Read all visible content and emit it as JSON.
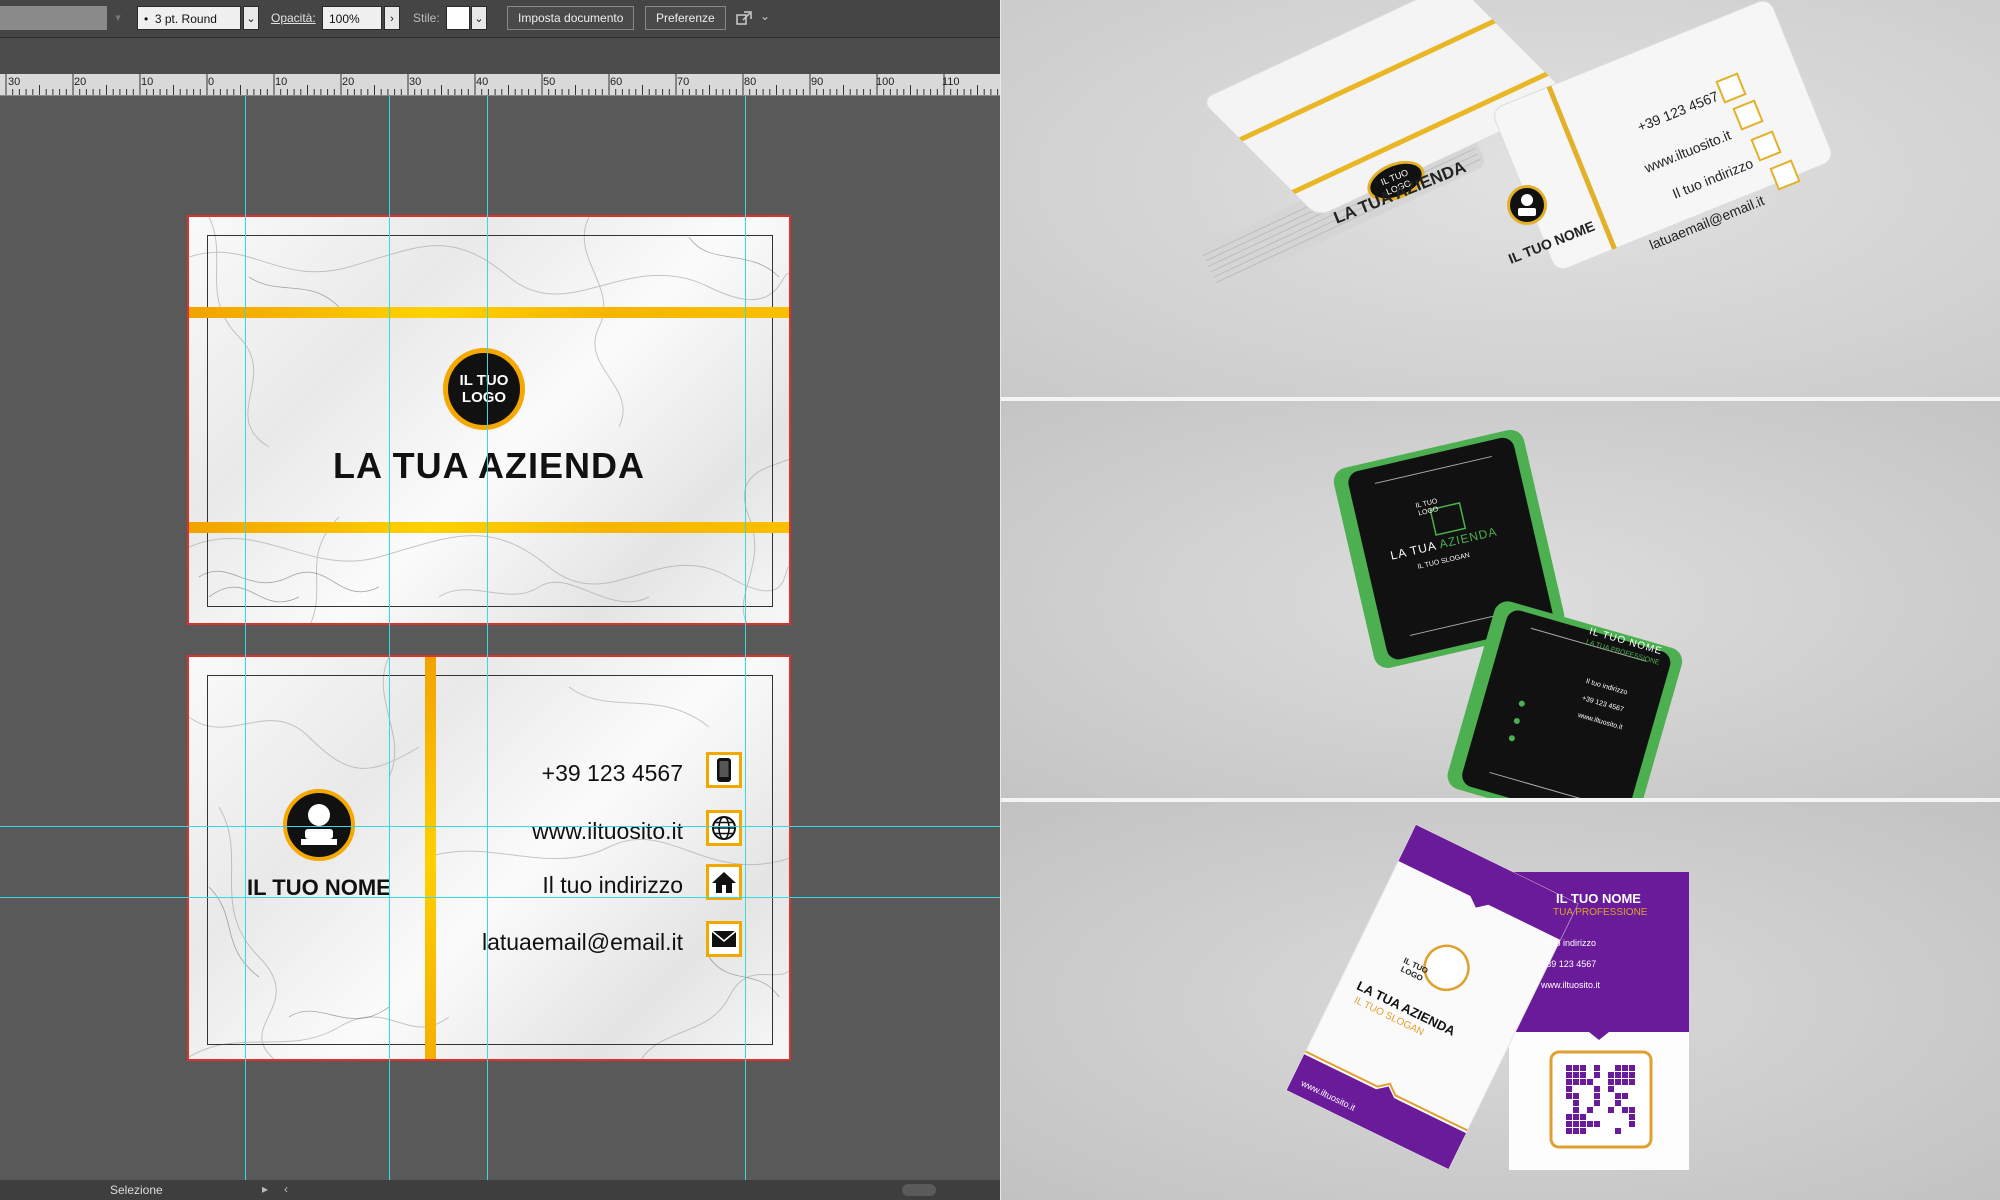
{
  "toolbar": {
    "stroke_profile": "3 pt. Round",
    "opacity_label": "Opacità:",
    "opacity_value": "100%",
    "style_label": "Stile:",
    "document_setup_button": "Imposta documento",
    "preferences_button": "Preferenze"
  },
  "ruler": {
    "ticks": [
      "30",
      "20",
      "10",
      "0",
      "10",
      "20",
      "30",
      "40",
      "50",
      "60",
      "70",
      "80",
      "90",
      "100",
      "110"
    ]
  },
  "front_card": {
    "logo_line1": "IL TUO",
    "logo_line2": "LOGO",
    "company": "LA TUA AZIENDA"
  },
  "back_card": {
    "name": "IL TUO NOME",
    "phone": "+39 123 4567",
    "website": "www.iltuosito.it",
    "address": "Il tuo indirizzo",
    "email": "latuaemail@email.it"
  },
  "status_bar": {
    "tool": "Selezione"
  },
  "mockup_marble": {
    "logo_line1": "IL TUO",
    "logo_line2": "LOGO",
    "company": "LA TUA AZIENDA",
    "name": "IL TUO NOME",
    "phone": "+39 123 4567",
    "website": "www.iltuosito.it",
    "address": "Il tuo indirizzo",
    "email": "latuaemail@email.it"
  },
  "mockup_green": {
    "logo_line1": "IL TUO",
    "logo_line2": "LOGO",
    "company_part1": "LA TUA ",
    "company_part2": "AZIENDA",
    "slogan": "IL TUO SLOGAN",
    "name": "IL TUO NOME",
    "profession": "LA TUA PROFESSIONE",
    "address": "Il tuo indirizzo",
    "phone": "+39 123 4567",
    "website": "www.iltuosito.it"
  },
  "mockup_purple": {
    "logo_line1": "IL TUO",
    "logo_line2": "LOGO",
    "company": "LA TUA AZIENDA",
    "slogan": "IL TUO SLOGAN",
    "website_front": "www.iltuosito.it",
    "name": "IL TUO NOME",
    "profession": "TUA PROFESSIONE",
    "address": "Il tuo indirizzo",
    "phone": "+39 123 4567",
    "website": "www.iltuosito.it"
  },
  "colors": {
    "gold": "#f5a800",
    "guide": "#36d9e6",
    "artboard_border": "#e0302b",
    "green": "#4caf50",
    "purple": "#6a1b9a"
  }
}
